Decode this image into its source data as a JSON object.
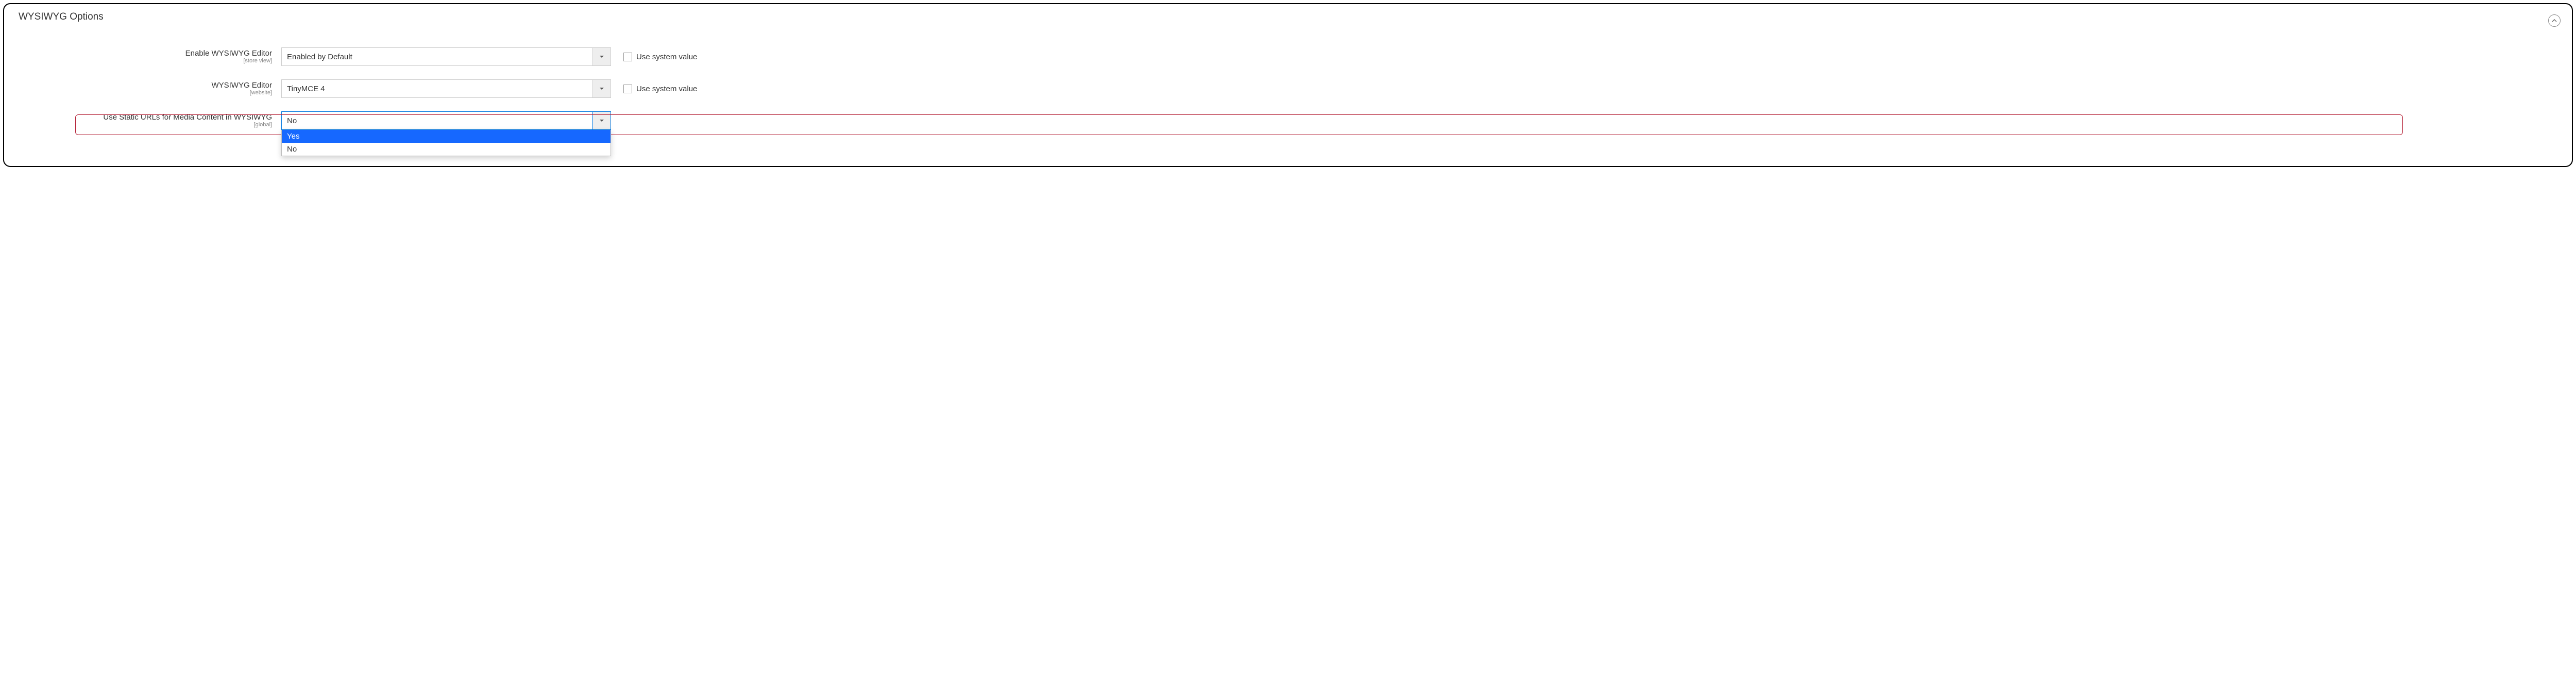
{
  "panel": {
    "title": "WYSIWYG Options"
  },
  "fields": {
    "enable": {
      "label": "Enable WYSIWYG Editor",
      "scope": "[store view]",
      "value": "Enabled by Default",
      "use_system": "Use system value"
    },
    "editor": {
      "label": "WYSIWYG Editor",
      "scope": "[website]",
      "value": "TinyMCE 4",
      "use_system": "Use system value"
    },
    "static_urls": {
      "label": "Use Static URLs for Media Content in WYSIWYG",
      "scope": "[global]",
      "value": "No",
      "options": {
        "yes": "Yes",
        "no": "No"
      }
    }
  }
}
